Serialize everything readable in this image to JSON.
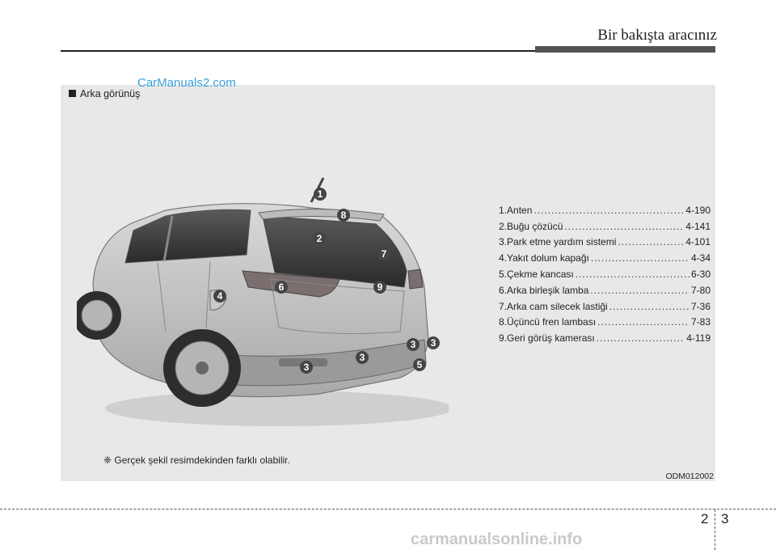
{
  "header": {
    "title": "Bir bakışta aracınız"
  },
  "section": {
    "title": "Arka görünüş"
  },
  "watermarks": {
    "top": "CarManuals2.com",
    "bottom": "carmanualsonline.info"
  },
  "callouts": [
    {
      "num": "1.",
      "label": "Anten",
      "page": "4-190"
    },
    {
      "num": "2.",
      "label": "Buğu çözücü",
      "page": "4-141"
    },
    {
      "num": "3.",
      "label": "Park etme yardım sistemi",
      "page": "4-101"
    },
    {
      "num": "4.",
      "label": "Yakıt dolum kapağı",
      "page": "4-34"
    },
    {
      "num": "5.",
      "label": "Çekme kancası",
      "page": "6-30"
    },
    {
      "num": "6.",
      "label": "Arka birleşik lamba",
      "page": "7-80"
    },
    {
      "num": "7.",
      "label": "Arka cam silecek lastiği",
      "page": "7-36"
    },
    {
      "num": "8.",
      "label": "Üçüncü fren lambası",
      "page": "7-83"
    },
    {
      "num": "9.",
      "label": "Geri görüş kamerası",
      "page": "4-119"
    }
  ],
  "badges": [
    "1",
    "8",
    "2",
    "7",
    "6",
    "9",
    "4",
    "3",
    "3",
    "3",
    "3",
    "5"
  ],
  "note": {
    "symbol": "❈",
    "text": "Gerçek şekil resimdekinden farklı olabilir."
  },
  "figure": {
    "code": "ODM012002"
  },
  "footer": {
    "chapter": "2",
    "page": "3"
  }
}
